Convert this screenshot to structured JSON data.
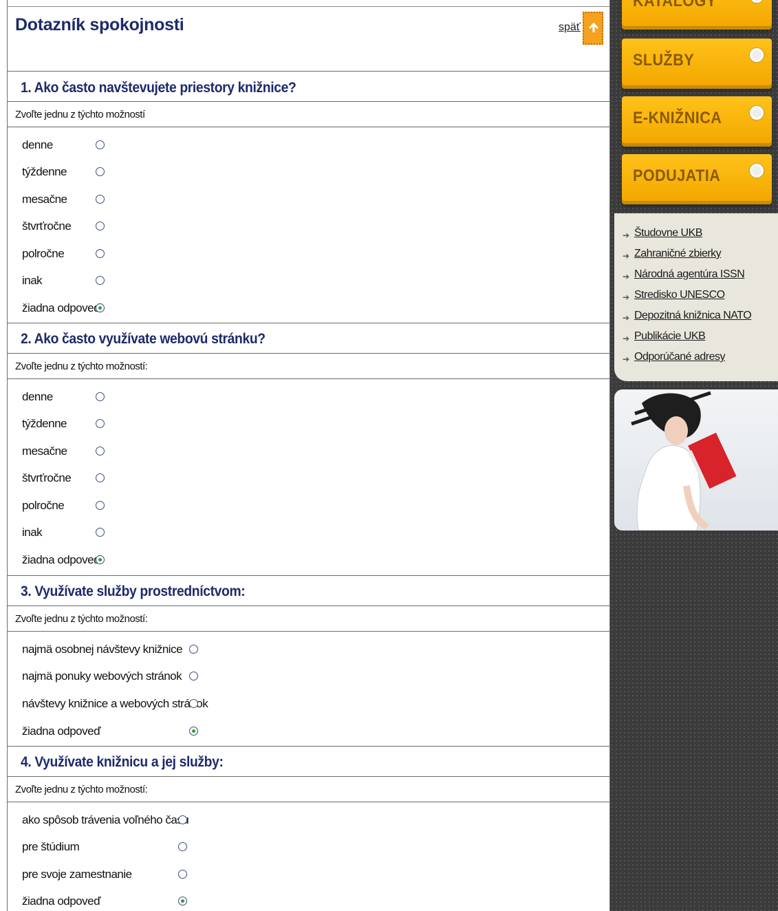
{
  "header": {
    "title": "Dotazník spokojnosti",
    "back_label": "späť"
  },
  "questions": [
    {
      "title": "1. Ako často navštevujete priestory knižnice?",
      "hint": "Zvoľte jednu z týchto možností",
      "options": [
        "denne",
        "týždenne",
        "mesačne",
        "štvrťročne",
        "polročne",
        "inak",
        "žiadna odpoveď"
      ],
      "selected": 6
    },
    {
      "title": "2.  Ako často využívate webovú stránku?",
      "hint": "Zvoľte jednu z týchto možností:",
      "options": [
        "denne",
        "týždenne",
        "mesačne",
        "štvrťročne",
        "polročne",
        "inak",
        "žiadna odpoveď"
      ],
      "selected": 6
    },
    {
      "title": "3. Využívate služby prostredníctvom:",
      "hint": "Zvoľte jednu z týchto možností:",
      "options": [
        "najmä osobnej návštevy knižnice",
        "najmä ponuky webových stránok",
        "návštevy knižnice a webových stránok",
        "žiadna odpoveď"
      ],
      "selected": 3
    },
    {
      "title": "4. Využívate knižnicu a jej služby:",
      "hint": "Zvoľte jednu z týchto možností:",
      "options": [
        "ako spôsob trávenia voľného času",
        "pre štúdium",
        "pre svoje zamestnanie",
        "žiadna odpoveď"
      ],
      "selected": 3
    }
  ],
  "sidebar": {
    "menu": [
      "KATALÓGY",
      "SLUŽBY",
      "E-KNIŽNICA",
      "PODUJATIA"
    ],
    "links": [
      "Študovne UKB",
      "Zahraničné zbierky",
      "Národná agentúra ISSN",
      "Stredisko UNESCO",
      "Depozitná knižnica NATO",
      "Publikácie UKB",
      "Odporúčané adresy"
    ]
  },
  "colors": {
    "heading": "#1d2a6b",
    "menu_orange": "#f6b40e",
    "radio_checked": "#2fa035"
  }
}
